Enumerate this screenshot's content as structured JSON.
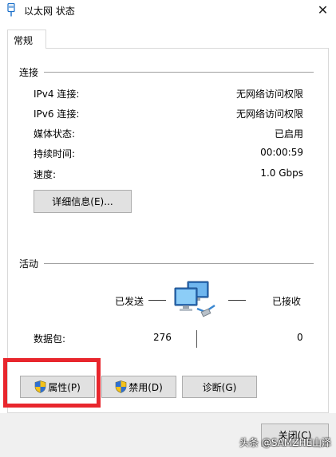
{
  "window": {
    "title": "以太网 状态",
    "icon": "ethernet-icon",
    "close_glyph": "✕"
  },
  "tabs": [
    {
      "label": "常规",
      "selected": true
    }
  ],
  "connection": {
    "section_title": "连接",
    "rows": [
      {
        "label": "IPv4 连接:",
        "value": "无网络访问权限"
      },
      {
        "label": "IPv6 连接:",
        "value": "无网络访问权限"
      },
      {
        "label": "媒体状态:",
        "value": "已启用"
      },
      {
        "label": "持续时间:",
        "value": "00:00:59"
      },
      {
        "label": "速度:",
        "value": "1.0 Gbps"
      }
    ],
    "details_button": "详细信息(E)..."
  },
  "activity": {
    "section_title": "活动",
    "sent_label": "已发送",
    "received_label": "已接收",
    "packets_label": "数据包:",
    "packets_sent": "276",
    "packets_received": "0",
    "icon": "network-computers-icon"
  },
  "buttons": {
    "properties": "属性(P)",
    "disable": "禁用(D)",
    "diagnose": "诊断(G)",
    "close": "关闭(C)"
  },
  "highlight_color": "#e8262d",
  "watermark": "头条 @SAMZHE山泽"
}
